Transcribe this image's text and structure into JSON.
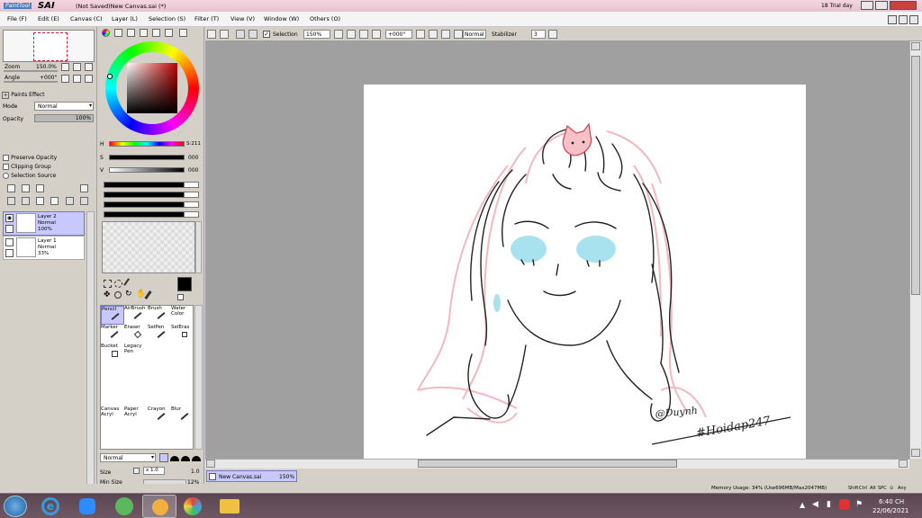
{
  "title": {
    "brand": "SAI",
    "brand_small": "PaintTool",
    "document": "(Not Saved)New Canvas.sai (*)",
    "trial": "18 Trial day"
  },
  "menu": [
    "File (F)",
    "Edit (E)",
    "Canvas (C)",
    "Layer (L)",
    "Selection (S)",
    "Filter (T)",
    "View (V)",
    "Window (W)",
    "Others (O)"
  ],
  "navigator": {
    "zoom_label": "Zoom",
    "zoom_value": "150.0%",
    "angle_label": "Angle",
    "angle_value": "+000°"
  },
  "layer_panel": {
    "paints_effect": "Paints Effect",
    "mode_label": "Mode",
    "mode_value": "Normal",
    "opacity_label": "Opacity",
    "opacity_value": "100%",
    "preserve_opacity": "Preserve Opacity",
    "clipping_group": "Clipping Group",
    "selection_source": "Selection Source",
    "layers": [
      {
        "name": "Layer 2",
        "mode": "Normal",
        "opacity": "100%",
        "selected": true
      },
      {
        "name": "Layer 1",
        "mode": "Normal",
        "opacity": "33%",
        "selected": false
      }
    ]
  },
  "color": {
    "h_label": "H",
    "h_value": "S:211",
    "s_label": "S",
    "s_value": "000",
    "v_label": "V",
    "v_value": "000"
  },
  "tools": [
    {
      "name": "Pencil",
      "selected": true
    },
    {
      "name": "AirBrush"
    },
    {
      "name": "Brush"
    },
    {
      "name": "Water Color"
    },
    {
      "name": "Marker"
    },
    {
      "name": "Eraser"
    },
    {
      "name": "SelPen"
    },
    {
      "name": "SelEras"
    },
    {
      "name": "Bucket"
    },
    {
      "name": "Legacy Pen"
    },
    {
      "name": "Canvas Acryl"
    },
    {
      "name": "Paper Acryl"
    },
    {
      "name": "Crayon"
    },
    {
      "name": "Blur"
    }
  ],
  "tool_settings": {
    "blend_mode": "Normal",
    "size_label": "Size",
    "size_mult": "x 1.0",
    "size_value": "1.0",
    "min_size_label": "Min Size",
    "min_size_value": "12%"
  },
  "toolbar": {
    "selection_label": "Selection",
    "zoom_value": "150%",
    "angle_value": "+000°",
    "mode_value": "Normal",
    "stabilizer_label": "Stabilizer",
    "stabilizer_value": "3"
  },
  "canvas": {
    "signature": "@Duynh",
    "hashtag": "#Hoidap247"
  },
  "tabs": [
    {
      "name": "New Canvas.sai",
      "zoom": "150%"
    }
  ],
  "status": {
    "memory": "Memory Usage: 34% (Use696MB/Max2047MB)",
    "keys": [
      "Shift",
      "Ctrl",
      "Alt",
      "SPC",
      "⊙",
      "Any"
    ]
  },
  "taskbar": {
    "time": "6:40 CH",
    "date": "22/06/2021"
  },
  "colors": {
    "accent": "#c8c8ff",
    "sketch_pink": "#f2b8c0",
    "eye_blue": "#a8e2ee",
    "titlebar": "#e7c3cf",
    "taskbar": "#5a4652"
  }
}
